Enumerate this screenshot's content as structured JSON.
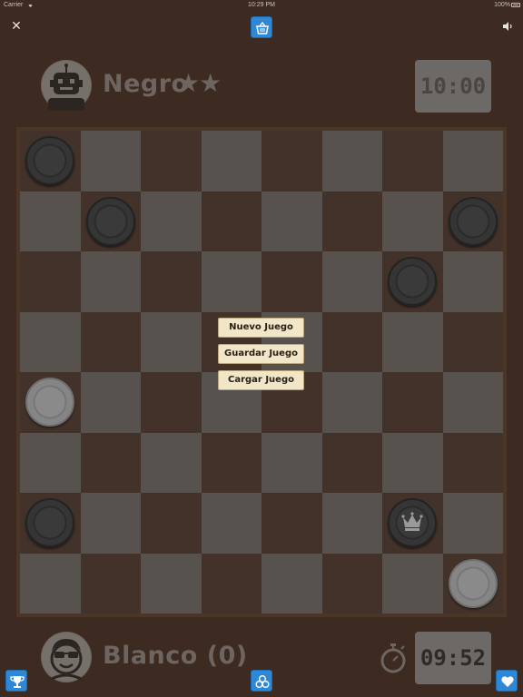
{
  "status_bar": {
    "carrier": "Carrier",
    "time": "10:29 PM",
    "battery": "100%"
  },
  "top_bar": {
    "close_icon": "close-icon",
    "store_icon": "basket-icon",
    "sound_icon": "speaker-icon"
  },
  "opponent": {
    "name": "Negro",
    "stars": "★★",
    "avatar_icon": "robot-avatar-icon",
    "timer": "10:00"
  },
  "player": {
    "name": "Blanco (0)",
    "avatar_icon": "sunglasses-avatar-icon",
    "timer": "09:52",
    "timer_icon": "stopwatch-icon"
  },
  "menu": {
    "new_game": "Nuevo Juego",
    "save_game": "Guardar Juego",
    "load_game": "Cargar Juego"
  },
  "bottom_bar": {
    "trophy_icon": "trophy-icon",
    "center_icon": "circles-icon",
    "heart_icon": "heart-icon"
  },
  "board": {
    "size": 8,
    "pieces": [
      {
        "row": 0,
        "col": 0,
        "color": "black",
        "king": false
      },
      {
        "row": 1,
        "col": 1,
        "color": "black",
        "king": false
      },
      {
        "row": 1,
        "col": 7,
        "color": "black",
        "king": false
      },
      {
        "row": 2,
        "col": 6,
        "color": "black",
        "king": false
      },
      {
        "row": 4,
        "col": 0,
        "color": "white",
        "king": false
      },
      {
        "row": 6,
        "col": 0,
        "color": "black",
        "king": false
      },
      {
        "row": 6,
        "col": 6,
        "color": "black",
        "king": true
      },
      {
        "row": 7,
        "col": 7,
        "color": "white",
        "king": false
      }
    ]
  },
  "colors": {
    "accent_blue": "#2f88d6",
    "background": "#3d2a20",
    "menu_button": "#f2e6c8"
  }
}
